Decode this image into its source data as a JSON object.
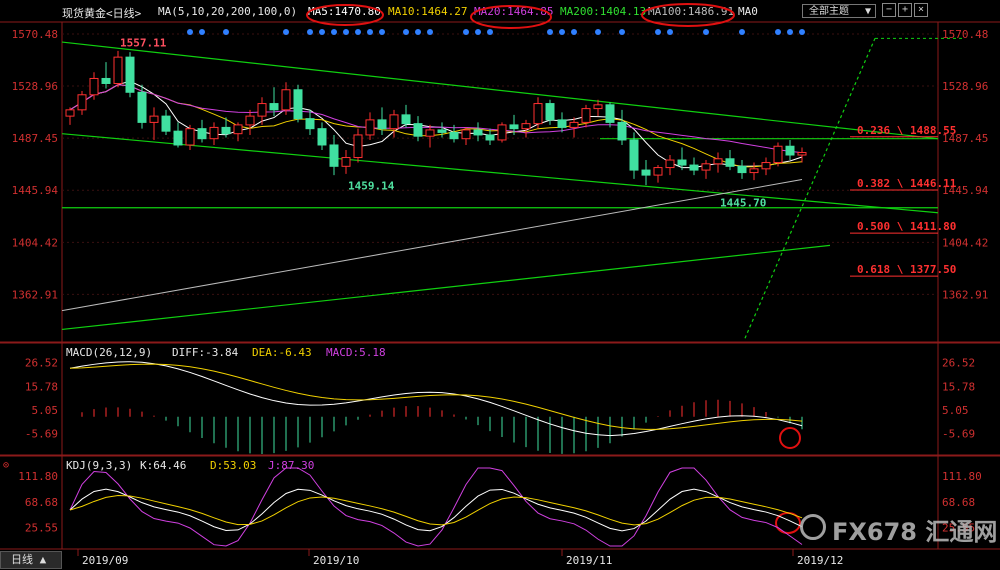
{
  "header": {
    "symbol": "现货黄金<日线>",
    "ma_label": "MA(5,10,20,200,100,0)",
    "ma5": "MA5:1470.80",
    "ma10": "MA10:1464.27",
    "ma20": "MA20:1464.85",
    "ma200": "MA200:1404.13",
    "ma100": "MA100:1486.91",
    "ma0": "MA0",
    "theme_select": "全部主题",
    "colors": {
      "ma5": "#ffffff",
      "ma10": "#f0d000",
      "ma20": "#d040e0",
      "ma200": "#30e030",
      "ma100": "#bbbbbb"
    }
  },
  "macd_header": {
    "label": "MACD(26,12,9)",
    "diff": "DIFF:-3.84",
    "dea": "DEA:-6.43",
    "macd": "MACD:5.18"
  },
  "kdj_header": {
    "label": "KDJ(9,3,3)",
    "k": "K:64.46",
    "d": "D:53.03",
    "j": "J:87.30"
  },
  "bottom_tab": "日线 ▲",
  "watermark": "FX678 汇通网",
  "chart_data": [
    {
      "type": "candlestick",
      "y_ticks": [
        "1570.48",
        "1528.96",
        "1487.45",
        "1445.94",
        "1404.42",
        "1362.91"
      ],
      "ylim": [
        1325,
        1580
      ],
      "x_labels": [
        "2019/09",
        "2019/10",
        "2019/11",
        "2019/12"
      ],
      "annotations": [
        {
          "text": "1557.11",
          "x": 4,
          "y": 1557.11
        },
        {
          "text": "1459.14",
          "x": 23,
          "y": 1459.14
        },
        {
          "text": "1445.70",
          "x": 54,
          "y": 1445.7
        }
      ],
      "fibonacci": [
        {
          "text": "0.236 \\ 1488.55",
          "value": 1488.55
        },
        {
          "text": "0.382 \\ 1446.11",
          "value": 1446.11
        },
        {
          "text": "0.500 \\ 1411.80",
          "value": 1411.8
        },
        {
          "text": "0.618 \\ 1377.50",
          "value": 1377.5
        }
      ],
      "candles": [
        [
          1505,
          1512,
          1498,
          1510
        ],
        [
          1510,
          1525,
          1506,
          1522
        ],
        [
          1522,
          1540,
          1518,
          1535
        ],
        [
          1535,
          1548,
          1527,
          1531
        ],
        [
          1531,
          1557,
          1528,
          1552
        ],
        [
          1552,
          1556,
          1520,
          1524
        ],
        [
          1524,
          1530,
          1495,
          1500
        ],
        [
          1500,
          1512,
          1486,
          1505
        ],
        [
          1505,
          1510,
          1490,
          1493
        ],
        [
          1493,
          1500,
          1480,
          1482
        ],
        [
          1482,
          1498,
          1478,
          1495
        ],
        [
          1495,
          1502,
          1484,
          1487
        ],
        [
          1487,
          1500,
          1482,
          1496
        ],
        [
          1496,
          1504,
          1488,
          1491
        ],
        [
          1491,
          1500,
          1485,
          1498
        ],
        [
          1498,
          1510,
          1490,
          1505
        ],
        [
          1505,
          1520,
          1498,
          1515
        ],
        [
          1515,
          1528,
          1505,
          1510
        ],
        [
          1510,
          1532,
          1506,
          1526
        ],
        [
          1526,
          1530,
          1500,
          1503
        ],
        [
          1503,
          1510,
          1490,
          1495
        ],
        [
          1495,
          1500,
          1478,
          1482
        ],
        [
          1482,
          1490,
          1458,
          1465
        ],
        [
          1465,
          1478,
          1459,
          1472
        ],
        [
          1472,
          1495,
          1468,
          1490
        ],
        [
          1490,
          1508,
          1486,
          1502
        ],
        [
          1502,
          1512,
          1490,
          1495
        ],
        [
          1495,
          1510,
          1488,
          1506
        ],
        [
          1506,
          1514,
          1496,
          1499
        ],
        [
          1499,
          1505,
          1485,
          1489
        ],
        [
          1489,
          1498,
          1480,
          1494
        ],
        [
          1494,
          1500,
          1488,
          1492
        ],
        [
          1492,
          1498,
          1484,
          1487
        ],
        [
          1487,
          1496,
          1482,
          1494
        ],
        [
          1494,
          1500,
          1485,
          1490
        ],
        [
          1490,
          1495,
          1482,
          1486
        ],
        [
          1486,
          1500,
          1484,
          1498
        ],
        [
          1498,
          1506,
          1490,
          1495
        ],
        [
          1495,
          1502,
          1488,
          1499
        ],
        [
          1499,
          1520,
          1495,
          1515
        ],
        [
          1515,
          1518,
          1498,
          1502
        ],
        [
          1502,
          1508,
          1492,
          1496
        ],
        [
          1496,
          1504,
          1488,
          1500
        ],
        [
          1500,
          1514,
          1496,
          1511
        ],
        [
          1511,
          1518,
          1505,
          1514
        ],
        [
          1514,
          1516,
          1496,
          1500
        ],
        [
          1500,
          1510,
          1482,
          1486
        ],
        [
          1486,
          1492,
          1455,
          1462
        ],
        [
          1462,
          1470,
          1450,
          1458
        ],
        [
          1458,
          1466,
          1452,
          1464
        ],
        [
          1464,
          1474,
          1458,
          1470
        ],
        [
          1470,
          1480,
          1462,
          1466
        ],
        [
          1466,
          1472,
          1458,
          1462
        ],
        [
          1462,
          1470,
          1455,
          1467
        ],
        [
          1467,
          1476,
          1460,
          1471
        ],
        [
          1471,
          1478,
          1462,
          1465
        ],
        [
          1465,
          1470,
          1455,
          1460
        ],
        [
          1460,
          1468,
          1454,
          1463
        ],
        [
          1463,
          1472,
          1458,
          1468
        ],
        [
          1468,
          1484,
          1465,
          1481
        ],
        [
          1481,
          1486,
          1470,
          1474
        ],
        [
          1474,
          1480,
          1468,
          1476
        ]
      ]
    },
    {
      "type": "bar",
      "y_ticks": [
        "26.52",
        "15.78",
        "5.05",
        "-5.69"
      ],
      "ylim": [
        -14,
        30
      ]
    },
    {
      "type": "line",
      "y_ticks": [
        "111.80",
        "68.68",
        "25.55"
      ],
      "ylim": [
        -5,
        125
      ]
    }
  ]
}
